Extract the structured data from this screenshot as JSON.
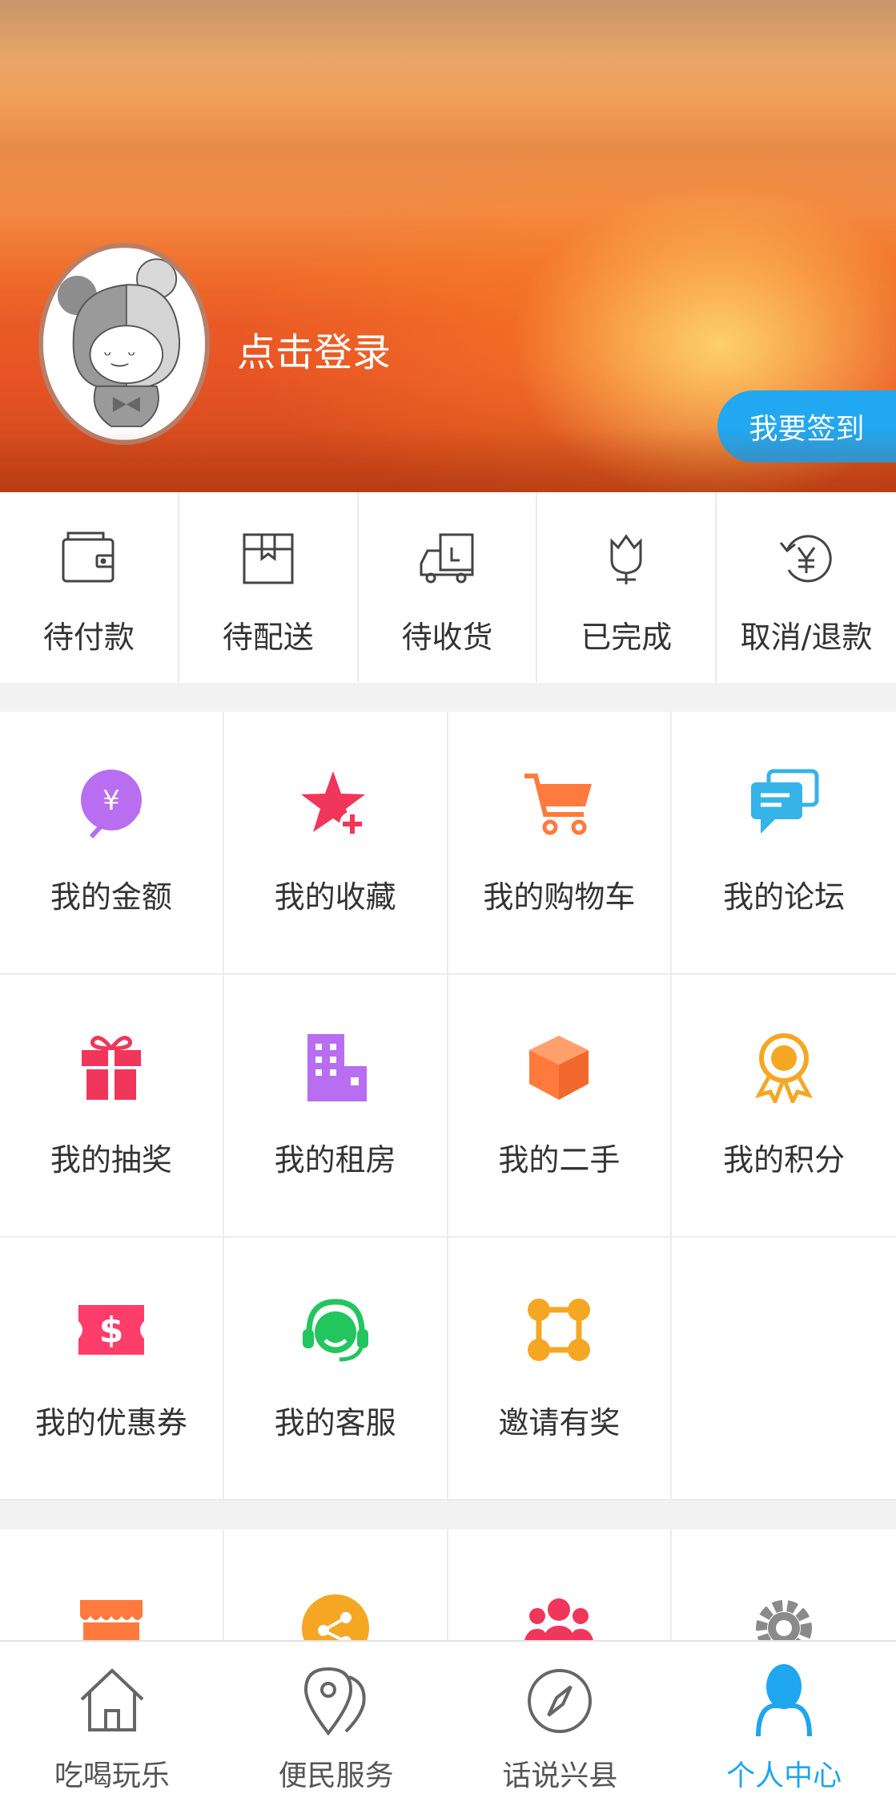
{
  "profile": {
    "login_text": "点击登录",
    "signin_label": "我要签到"
  },
  "orders": [
    {
      "label": "待付款",
      "icon": "wallet-icon"
    },
    {
      "label": "待配送",
      "icon": "package-icon"
    },
    {
      "label": "待收货",
      "icon": "truck-icon"
    },
    {
      "label": "已完成",
      "icon": "flower-icon"
    },
    {
      "label": "取消/退款",
      "icon": "refund-icon"
    }
  ],
  "menu": [
    {
      "label": "我的金额",
      "icon": "money-icon",
      "color": "#b96df0"
    },
    {
      "label": "我的收藏",
      "icon": "star-icon",
      "color": "#f0365a"
    },
    {
      "label": "我的购物车",
      "icon": "cart-icon",
      "color": "#ff7a3c"
    },
    {
      "label": "我的论坛",
      "icon": "chat-icon",
      "color": "#36b3e8"
    },
    {
      "label": "我的抽奖",
      "icon": "gift-icon",
      "color": "#f0365a"
    },
    {
      "label": "我的租房",
      "icon": "building-icon",
      "color": "#b96df0"
    },
    {
      "label": "我的二手",
      "icon": "box-icon",
      "color": "#ff7a3c"
    },
    {
      "label": "我的积分",
      "icon": "medal-icon",
      "color": "#f5a623"
    },
    {
      "label": "我的优惠券",
      "icon": "coupon-icon",
      "color": "#ff3d6b"
    },
    {
      "label": "我的客服",
      "icon": "headset-icon",
      "color": "#22c55e"
    },
    {
      "label": "邀请有奖",
      "icon": "invite-icon",
      "color": "#f5a623"
    }
  ],
  "menu_more": [
    {
      "icon": "shop-icon",
      "color": "#ff7a3c"
    },
    {
      "icon": "share-icon",
      "color": "#f5a623"
    },
    {
      "icon": "group-icon",
      "color": "#f0365a"
    },
    {
      "icon": "gear-icon",
      "color": "#8a8a8a"
    }
  ],
  "tabs": [
    {
      "label": "吃喝玩乐",
      "icon": "home-icon"
    },
    {
      "label": "便民服务",
      "icon": "location-icon"
    },
    {
      "label": "话说兴县",
      "icon": "compass-icon"
    },
    {
      "label": "个人中心",
      "icon": "person-icon",
      "active": true
    }
  ]
}
